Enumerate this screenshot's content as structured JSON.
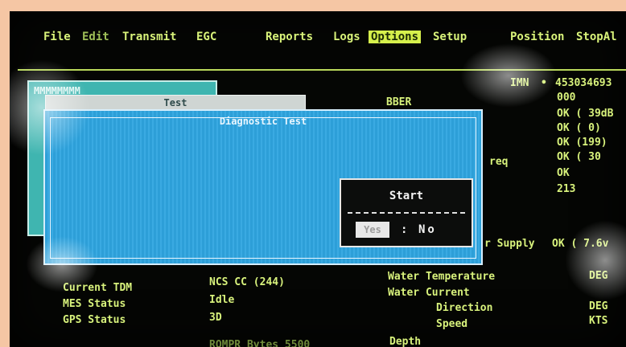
{
  "menu": {
    "items": [
      {
        "label": "File",
        "state": "normal"
      },
      {
        "label": "Edit",
        "state": "disabled"
      },
      {
        "label": "Transmit",
        "state": "normal"
      },
      {
        "label": "EGC",
        "state": "normal"
      },
      {
        "label": "Reports",
        "state": "normal"
      },
      {
        "label": "Logs",
        "state": "normal"
      },
      {
        "label": "Options",
        "state": "highlighted"
      },
      {
        "label": "Setup",
        "state": "normal"
      },
      {
        "label": "Position",
        "state": "normal"
      },
      {
        "label": "StopAl",
        "state": "normal"
      }
    ]
  },
  "status": {
    "imn_label": "IMN",
    "imn_arrow": "•",
    "imn_value": "453034693",
    "ber_label": "BBER",
    "ber_value": "000",
    "rows": [
      "OK ( 39dB",
      "OK (  0)",
      "OK (199)",
      "OK (   30",
      "OK",
      "213"
    ],
    "freq_label": "req",
    "supply_label": "r Supply",
    "supply_value": "OK ( 7.6v"
  },
  "bottom": {
    "labels": [
      "Current TDM",
      "MES Status",
      "GPS Status"
    ],
    "values": [
      "NCS CC (244)",
      "Idle",
      "3D"
    ],
    "water_labels": [
      "Water Temperature",
      "Water Current"
    ],
    "current_sub": [
      "Direction",
      "Speed"
    ],
    "units": [
      "DEG",
      "DEG",
      "KTS"
    ],
    "depth_label": "Depth",
    "partial": "ROMPR Bytes 5500"
  },
  "windows": {
    "back_title": "MMMMMMMM",
    "test_title": "Test",
    "diag_title": "Diagnostic Test"
  },
  "dialog": {
    "title": "Start",
    "yes_label": "Yes",
    "separator": ":",
    "no_label": "No"
  },
  "colors": {
    "screen_text": "#d8f27c",
    "highlight": "#d6f04c",
    "window_blue": "#2d9fd8",
    "frame": "#f5c6a4"
  }
}
